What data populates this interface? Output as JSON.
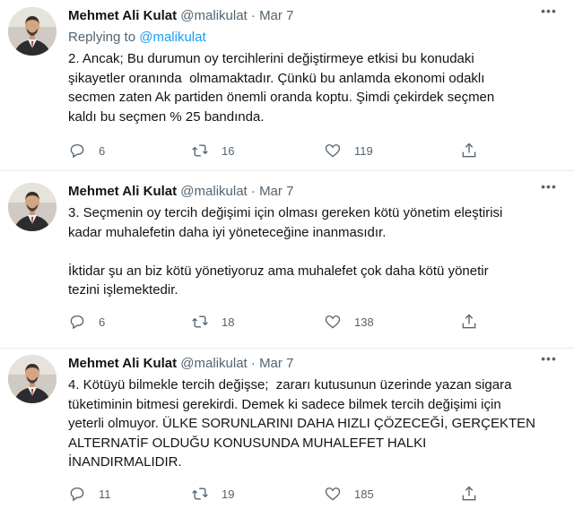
{
  "tweets": [
    {
      "author_name": "Mehmet Ali Kulat",
      "handle": "@malikulat",
      "separator": "·",
      "date": "Mar 7",
      "replying_prefix": "Replying to ",
      "replying_handle": "@malikulat",
      "text": "2. Ancak; Bu durumun oy tercihlerini değiştirmeye etkisi bu konudaki\nşikayetler oranında  olmamaktadır. Çünkü bu anlamda ekonomi odaklı\nsecmen zaten Ak partiden önemli oranda koptu. Şimdi çekirdek seçmen\nkaldı bu seçmen % 25 bandında.",
      "replies": "6",
      "retweets": "16",
      "likes": "119"
    },
    {
      "author_name": "Mehmet Ali Kulat",
      "handle": "@malikulat",
      "separator": "·",
      "date": "Mar 7",
      "text": "3. Seçmenin oy tercih değişimi için olması gereken kötü yönetim eleştirisi\nkadar muhalefetin daha iyi yöneteceğine inanmasıdır.\n\nİktidar şu an biz kötü yönetiyoruz ama muhalefet çok daha kötü yönetir\ntezini işlemektedir.",
      "replies": "6",
      "retweets": "18",
      "likes": "138"
    },
    {
      "author_name": "Mehmet Ali Kulat",
      "handle": "@malikulat",
      "separator": "·",
      "date": "Mar 7",
      "text": "4. Kötüyü bilmekle tercih değişse;  zararı kutusunun üzerinde yazan sigara\ntüketiminin bitmesi gerekirdi. Demek ki sadece bilmek tercih değişimi için\nyeterli olmuyor. ÜLKE SORUNLARINI DAHA HIZLI ÇÖZECEĞİ, GERÇEKTEN\nALTERNATİF OLDUĞU KONUSUNDA MUHALEFET HALKI\nİNANDIRMALIDIR.",
      "replies": "11",
      "retweets": "19",
      "likes": "185"
    }
  ],
  "icons": {
    "more": "more-icon",
    "reply": "reply-icon",
    "retweet": "retweet-icon",
    "like": "like-icon",
    "share": "share-icon"
  },
  "colors": {
    "link": "#1d9bf0",
    "secondary_text": "#536471",
    "primary_text": "#0f1419",
    "divider": "#e7e9ea"
  }
}
